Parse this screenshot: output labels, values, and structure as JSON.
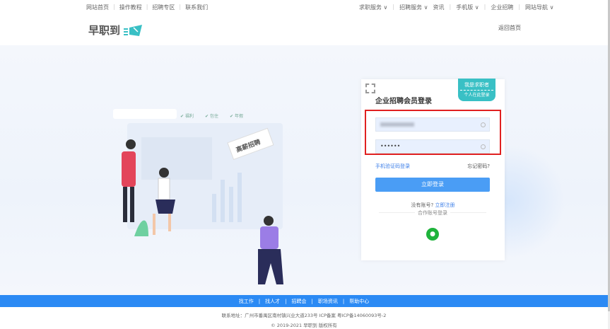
{
  "topbar": {
    "left": [
      "网站首页",
      "操作教程",
      "招聘专区",
      "联系我们"
    ],
    "right": [
      "求职服务 ∨",
      "招聘服务 ∨",
      "资讯",
      "手机版 ∨",
      "企业招聘",
      "网站导航 ∨"
    ]
  },
  "logo": {
    "text": "早职到"
  },
  "header": {
    "back": "返回首页"
  },
  "illustration": {
    "sign": "高薪招聘",
    "tags": [
      "福利",
      "包住",
      "年假"
    ]
  },
  "login": {
    "title": "企业招聘会员登录",
    "badge_main": "我是求职者",
    "badge_sub": "个人在此登录",
    "password": "••••••",
    "sms_login": "手机验证码登录",
    "forgot": "忘记密码?",
    "submit": "立即登录",
    "no_account": "没有账号?",
    "register": "立即注册",
    "other_login": "合作账号登录"
  },
  "footer": {
    "nav": [
      "找工作",
      "找人才",
      "招聘会",
      "职场资讯",
      "帮助中心"
    ],
    "address": "联系地址：广州市番禺区南村镇兴业大道233号 ICP备案 粤ICP备14060093号-2",
    "copyright": "© 2019-2021 早职到 版权所有"
  },
  "colors": {
    "accent": "#2b8af4",
    "teal": "#39c0c5",
    "red": "#e02020"
  }
}
